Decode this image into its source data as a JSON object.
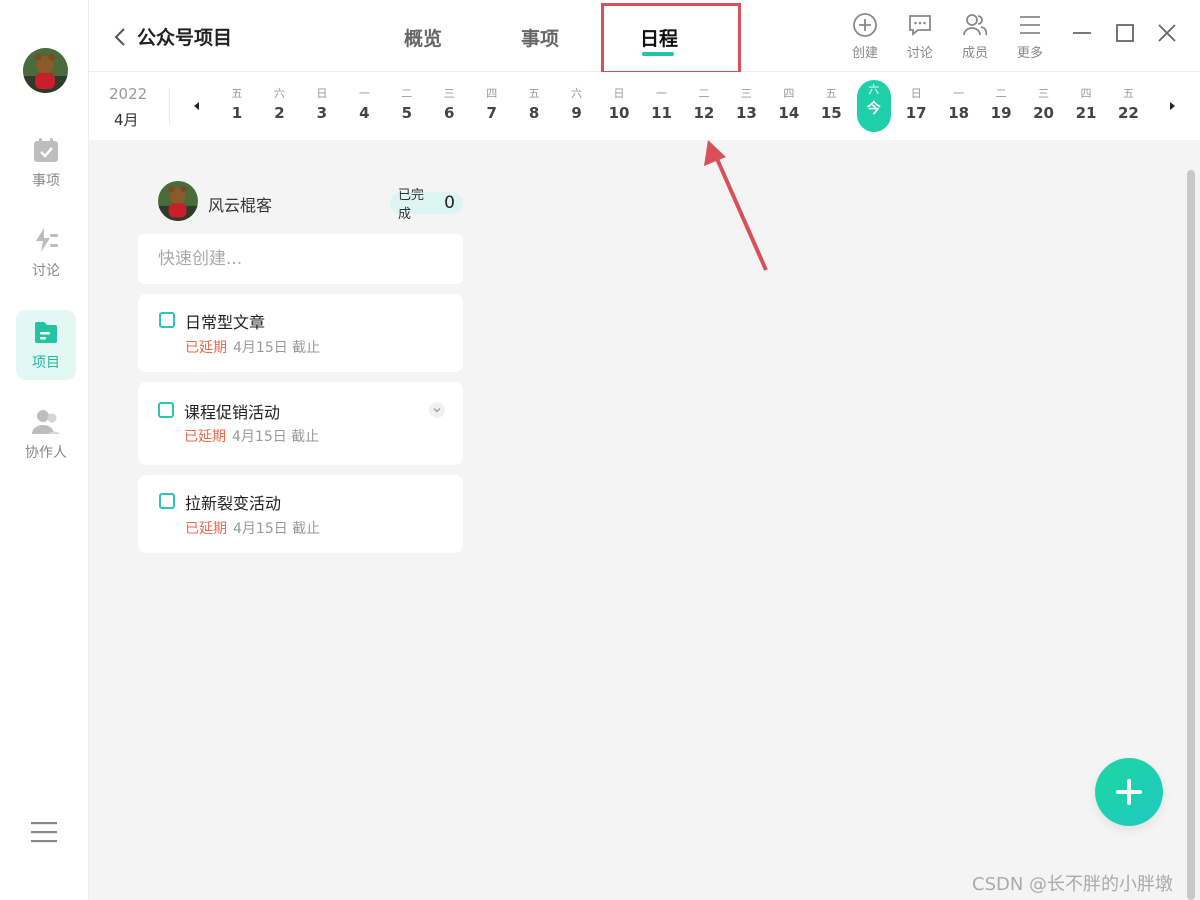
{
  "sidebar": {
    "items": [
      {
        "label": "事项",
        "icon": "calendar-check-icon"
      },
      {
        "label": "讨论",
        "icon": "bolt-lines-icon"
      },
      {
        "label": "项目",
        "icon": "folder-icon",
        "active": true
      },
      {
        "label": "协作人",
        "icon": "people-icon"
      }
    ]
  },
  "header": {
    "title": "公众号项目",
    "tabs": [
      {
        "label": "概览"
      },
      {
        "label": "事项"
      },
      {
        "label": "日程",
        "active": true
      }
    ],
    "tools": [
      {
        "label": "创建",
        "icon": "plus-circle-icon"
      },
      {
        "label": "讨论",
        "icon": "chat-icon"
      },
      {
        "label": "成员",
        "icon": "members-icon"
      },
      {
        "label": "更多",
        "icon": "menu-icon"
      }
    ]
  },
  "datebar": {
    "year": "2022",
    "month": "4月",
    "days": [
      {
        "wk": "五",
        "d": "1"
      },
      {
        "wk": "六",
        "d": "2"
      },
      {
        "wk": "日",
        "d": "3"
      },
      {
        "wk": "一",
        "d": "4"
      },
      {
        "wk": "二",
        "d": "5"
      },
      {
        "wk": "三",
        "d": "6"
      },
      {
        "wk": "四",
        "d": "7"
      },
      {
        "wk": "五",
        "d": "8"
      },
      {
        "wk": "六",
        "d": "9"
      },
      {
        "wk": "日",
        "d": "10"
      },
      {
        "wk": "一",
        "d": "11"
      },
      {
        "wk": "二",
        "d": "12"
      },
      {
        "wk": "三",
        "d": "13"
      },
      {
        "wk": "四",
        "d": "14"
      },
      {
        "wk": "五",
        "d": "15"
      },
      {
        "wk": "六",
        "d": "今",
        "today": true
      },
      {
        "wk": "日",
        "d": "17"
      },
      {
        "wk": "一",
        "d": "18"
      },
      {
        "wk": "二",
        "d": "19"
      },
      {
        "wk": "三",
        "d": "20"
      },
      {
        "wk": "四",
        "d": "21"
      },
      {
        "wk": "五",
        "d": "22"
      }
    ]
  },
  "member": {
    "name": "风云棍客",
    "done_label": "已完成",
    "done_count": "0"
  },
  "quick_create": {
    "placeholder": "快速创建..."
  },
  "tasks": [
    {
      "title": "日常型文章",
      "status": "已延期",
      "due": "4月15日 截止"
    },
    {
      "title": "课程促销活动",
      "status": "已延期",
      "due": "4月15日 截止"
    },
    {
      "title": "拉新裂变活动",
      "status": "已延期",
      "due": "4月15日 截止"
    }
  ],
  "watermark": "CSDN @长不胖的小胖墩",
  "colors": {
    "accent": "#22c4a4",
    "overdue": "#ee6a4a",
    "annotation": "#d9505a"
  }
}
